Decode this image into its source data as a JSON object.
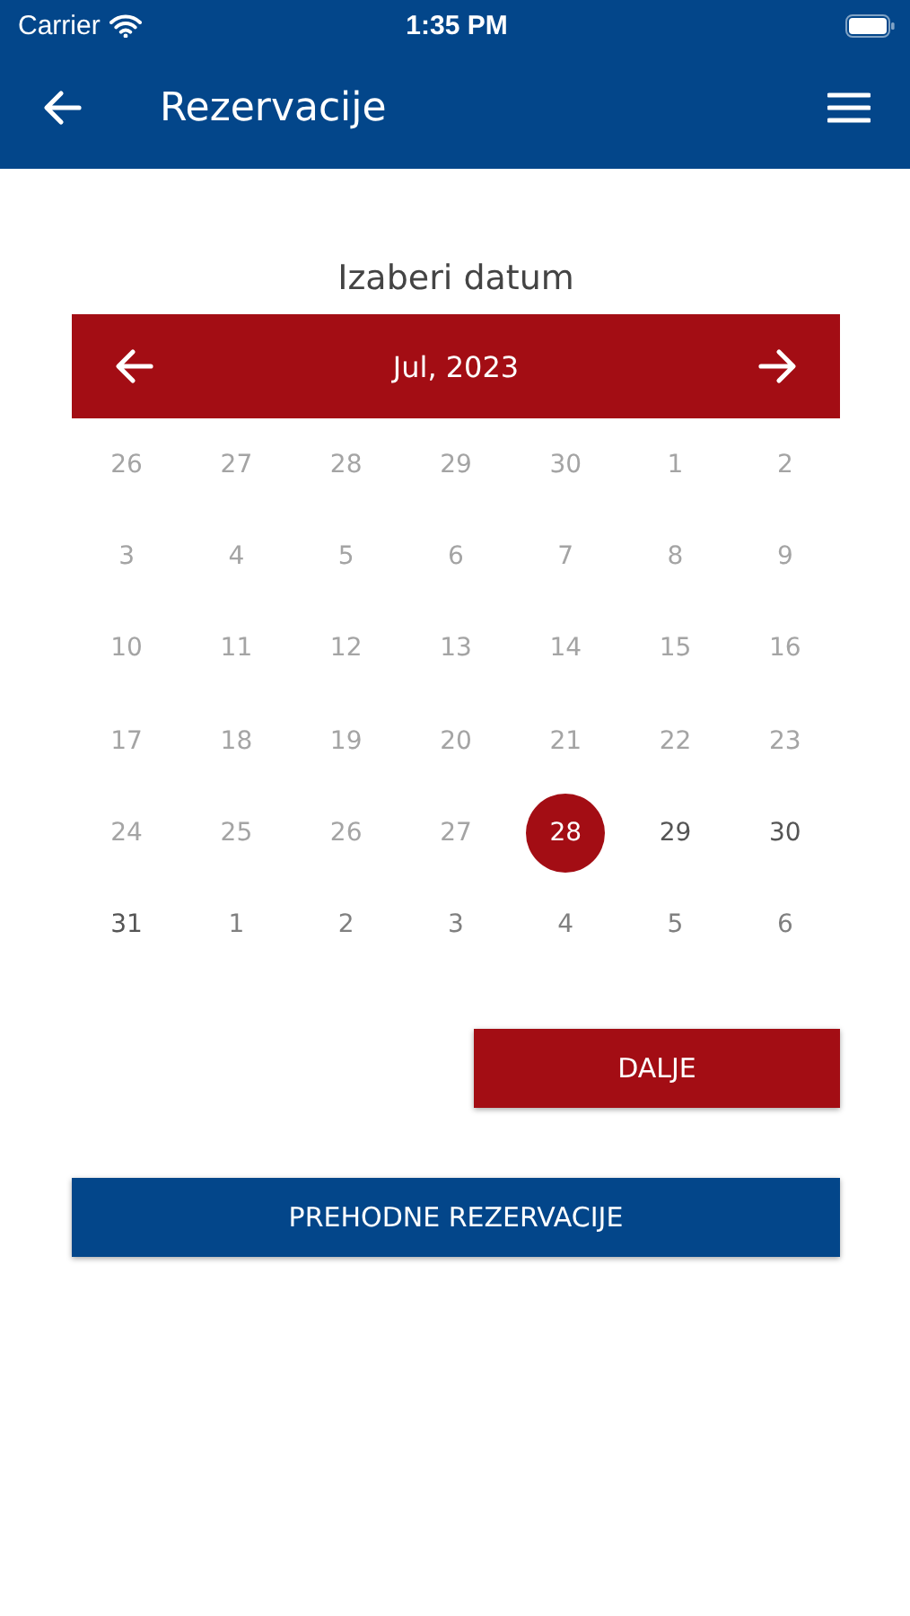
{
  "status_bar": {
    "carrier": "Carrier",
    "time": "1:35 PM"
  },
  "nav_bar": {
    "title": "Rezervacije"
  },
  "heading": "Izaberi datum",
  "calendar": {
    "month": "Jul, 2023",
    "weeks": [
      [
        {
          "day": "26",
          "disabled": true,
          "selected": false
        },
        {
          "day": "27",
          "disabled": true,
          "selected": false
        },
        {
          "day": "28",
          "disabled": true,
          "selected": false
        },
        {
          "day": "29",
          "disabled": true,
          "selected": false
        },
        {
          "day": "30",
          "disabled": true,
          "selected": false
        },
        {
          "day": "1",
          "disabled": true,
          "selected": false
        },
        {
          "day": "2",
          "disabled": true,
          "selected": false
        }
      ],
      [
        {
          "day": "3",
          "disabled": true,
          "selected": false
        },
        {
          "day": "4",
          "disabled": true,
          "selected": false
        },
        {
          "day": "5",
          "disabled": true,
          "selected": false
        },
        {
          "day": "6",
          "disabled": true,
          "selected": false
        },
        {
          "day": "7",
          "disabled": true,
          "selected": false
        },
        {
          "day": "8",
          "disabled": true,
          "selected": false
        },
        {
          "day": "9",
          "disabled": true,
          "selected": false
        }
      ],
      [
        {
          "day": "10",
          "disabled": true,
          "selected": false
        },
        {
          "day": "11",
          "disabled": true,
          "selected": false
        },
        {
          "day": "12",
          "disabled": true,
          "selected": false
        },
        {
          "day": "13",
          "disabled": true,
          "selected": false
        },
        {
          "day": "14",
          "disabled": true,
          "selected": false
        },
        {
          "day": "15",
          "disabled": true,
          "selected": false
        },
        {
          "day": "16",
          "disabled": true,
          "selected": false
        }
      ],
      [
        {
          "day": "17",
          "disabled": true,
          "selected": false
        },
        {
          "day": "18",
          "disabled": true,
          "selected": false
        },
        {
          "day": "19",
          "disabled": true,
          "selected": false
        },
        {
          "day": "20",
          "disabled": true,
          "selected": false
        },
        {
          "day": "21",
          "disabled": true,
          "selected": false
        },
        {
          "day": "22",
          "disabled": true,
          "selected": false
        },
        {
          "day": "23",
          "disabled": true,
          "selected": false
        }
      ],
      [
        {
          "day": "24",
          "disabled": true,
          "selected": false
        },
        {
          "day": "25",
          "disabled": true,
          "selected": false
        },
        {
          "day": "26",
          "disabled": true,
          "selected": false
        },
        {
          "day": "27",
          "disabled": true,
          "selected": false
        },
        {
          "day": "28",
          "disabled": false,
          "outside_month": false,
          "selected": true
        },
        {
          "day": "29",
          "disabled": false,
          "outside_month": false,
          "selected": false
        },
        {
          "day": "30",
          "disabled": false,
          "outside_month": false,
          "selected": false
        }
      ],
      [
        {
          "day": "31",
          "disabled": false,
          "outside_month": false,
          "selected": false
        },
        {
          "day": "1",
          "disabled": false,
          "outside_month": true,
          "selected": false
        },
        {
          "day": "2",
          "disabled": false,
          "outside_month": true,
          "selected": false
        },
        {
          "day": "3",
          "disabled": false,
          "outside_month": true,
          "selected": false
        },
        {
          "day": "4",
          "disabled": false,
          "outside_month": true,
          "selected": false
        },
        {
          "day": "5",
          "disabled": false,
          "outside_month": true,
          "selected": false
        },
        {
          "day": "6",
          "disabled": false,
          "outside_month": true,
          "selected": false
        }
      ]
    ]
  },
  "next_button": "DALJE",
  "previous_reservations_button": "PREHODNE REZERVACIJE"
}
